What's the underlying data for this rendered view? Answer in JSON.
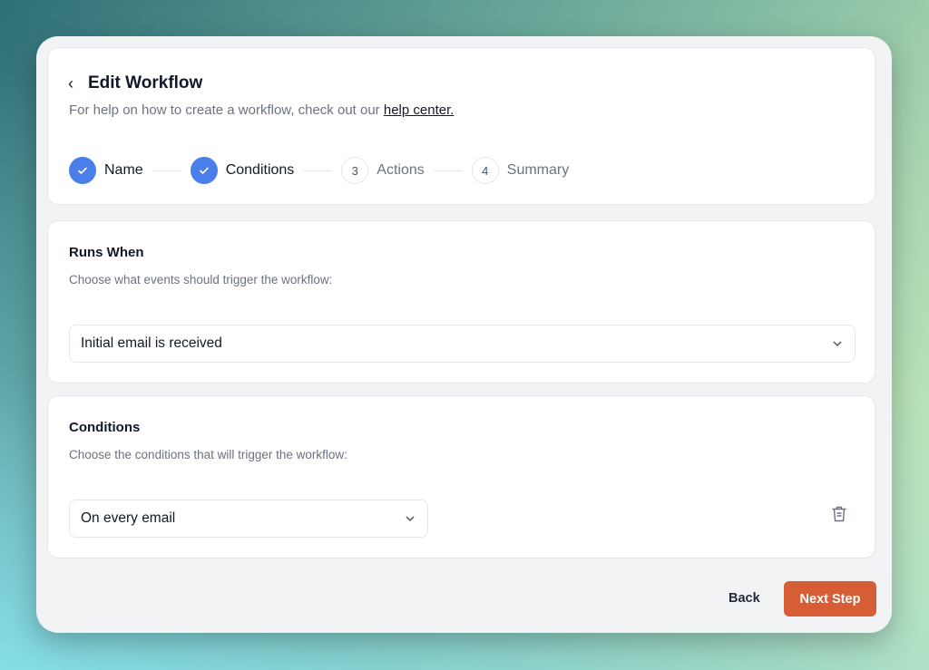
{
  "header": {
    "title": "Edit Workflow",
    "subtitle": "For help on how to create a workflow, check out our ",
    "help_link": "help center."
  },
  "steps": [
    {
      "label": "Name",
      "status": "complete"
    },
    {
      "label": "Conditions",
      "status": "complete"
    },
    {
      "number": "3",
      "label": "Actions",
      "status": "pending"
    },
    {
      "number": "4",
      "label": "Summary",
      "status": "pending"
    }
  ],
  "runs_when": {
    "title": "Runs When",
    "description": "Choose what events should trigger the workflow:",
    "selected": "Initial email is received"
  },
  "conditions": {
    "title": "Conditions",
    "description": "Choose the conditions that will trigger the workflow:",
    "selected": "On every email"
  },
  "footer": {
    "back_label": "Back",
    "next_label": "Next Step"
  },
  "colors": {
    "accent": "#4a7ee8",
    "primary_button": "#d65d36"
  }
}
